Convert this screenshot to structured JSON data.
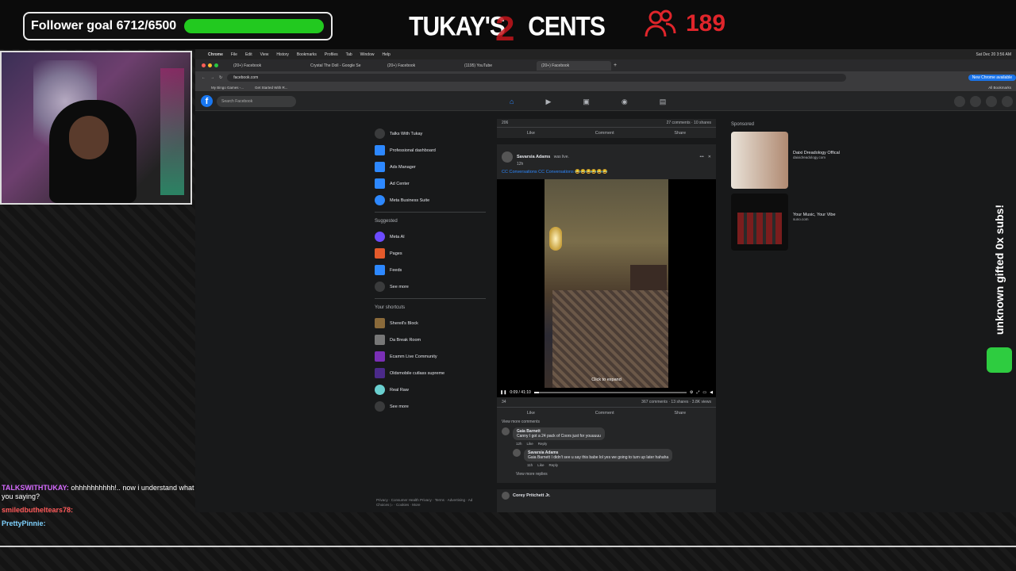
{
  "overlay": {
    "follower_goal": "Follower goal 6712/6500",
    "follower_progress": 1.0,
    "logo": "TUKAY'S",
    "logo_cents": "CENTS",
    "viewer_count": "189",
    "gift_side_text": "unknown gifted 0x subs!",
    "colors": {
      "goal_bar": "#22c91f",
      "viewer": "#e0252b"
    }
  },
  "chat": [
    {
      "user": "TALKSWITHTUKAY:",
      "msg": "ohhhhhhhhhh!.. now i understand what you saying?"
    },
    {
      "user": "smiledbutheltears78:",
      "msg": ""
    },
    {
      "user": "PrettyPinnie:",
      "msg": ""
    }
  ],
  "browser": {
    "menubar": [
      "Chrome",
      "File",
      "Edit",
      "View",
      "History",
      "Bookmarks",
      "Profiles",
      "Tab",
      "Window",
      "Help"
    ],
    "datetime": "Sat Dec 20 3:56 AM",
    "tabs": [
      "(20+) Facebook",
      "Crystal The Doll - Google Se",
      "(20+) Facebook",
      "(1195) YouTube",
      "(20+) Facebook"
    ],
    "url": "facebook.com",
    "new_chrome": "New Chrome available",
    "bookmarks": [
      "My Bingo Games -...",
      "Get Started With R...",
      "All Bookmarks"
    ]
  },
  "facebook": {
    "search_placeholder": "Search Facebook",
    "left_menu": [
      "Talks With Tukay",
      "Professional dashboard",
      "Ads Manager",
      "Ad Center",
      "Meta Business Suite"
    ],
    "suggested_label": "Suggested",
    "suggested": [
      "Meta AI",
      "Pages",
      "Feeds",
      "See more"
    ],
    "shortcuts_label": "Your shortcuts",
    "shortcuts": [
      "Shereil's Block",
      "Da Break Room",
      "Ecamm Live Community",
      "Oldsmobile cutlass supreme",
      "Real Raw",
      "See more"
    ],
    "footer": "Privacy · Consumer Health Privacy · Terms · Advertising · Ad Choices ▷ · Cookies · More",
    "prev_post": {
      "reactions": "206",
      "counts": "27 comments · 10 shares"
    },
    "post": {
      "author": "Savarsia Adams",
      "status": "was live.",
      "time": "12h",
      "caption": "CC Conversations CC Conversations 😂😂😂😂😂😂",
      "expand": "Click to expand",
      "time_code": "0:09 / 41:10",
      "progress": 0.03,
      "reactions": "34",
      "counts": "367 comments · 13 shares · 3.8K views",
      "view_more": "View more comments",
      "view_replies": "View more replies",
      "next_author": "Corey Pritchett Jr."
    },
    "actions": {
      "like": "Like",
      "comment": "Comment",
      "share": "Share",
      "reply": "Reply"
    },
    "comments": [
      {
        "name": "Gaia Barnett",
        "text": "Canny I got a 24 pack of Coors just for youuuuu",
        "time": "12h"
      },
      {
        "name": "Savarsia Adams",
        "text": "Gaia Barnett I didn't see u say this babe lol yes we going to turn up later hahaha",
        "time": "11h"
      }
    ],
    "sponsored_label": "Sponsored",
    "ads": [
      {
        "title": "Daixi Dreadology Offical",
        "url": "daixidreadology.com"
      },
      {
        "title": "Your Music, Your Vibe",
        "url": "suno.com"
      }
    ]
  }
}
